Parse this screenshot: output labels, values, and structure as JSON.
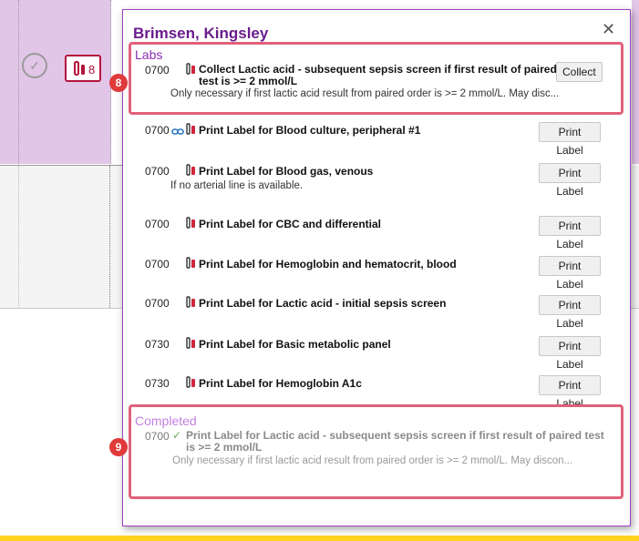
{
  "patient": {
    "name": "Brimsen, Kingsley"
  },
  "sidebar": {
    "task_count": "8"
  },
  "sections": {
    "labs": "Labs",
    "completed": "Completed"
  },
  "labs": [
    {
      "time": "0700",
      "title": "Collect Lactic acid - subsequent sepsis screen if first result of paired test is >= 2 mmol/L",
      "note": "Only necessary if first lactic acid result from paired order is >= 2 mmol/L. May disc...",
      "action": "Collect",
      "linked": false
    },
    {
      "time": "0700",
      "title": "Print Label for Blood culture, peripheral #1",
      "note": "",
      "action": "Print Label",
      "linked": true
    },
    {
      "time": "0700",
      "title": "Print Label for Blood gas, venous",
      "note": "If no arterial line is available.",
      "action": "Print Label",
      "linked": false
    },
    {
      "time": "0700",
      "title": "Print Label for CBC and differential",
      "note": "",
      "action": "Print Label",
      "linked": false
    },
    {
      "time": "0700",
      "title": "Print Label for Hemoglobin and hematocrit, blood",
      "note": "",
      "action": "Print Label",
      "linked": false
    },
    {
      "time": "0700",
      "title": "Print Label for Lactic acid - initial sepsis screen",
      "note": "",
      "action": "Print Label",
      "linked": false
    },
    {
      "time": "0730",
      "title": "Print Label for Basic metabolic panel",
      "note": "",
      "action": "Print Label",
      "linked": false
    },
    {
      "time": "0730",
      "title": "Print Label for Hemoglobin A1c",
      "note": "",
      "action": "Print Label",
      "linked": false
    }
  ],
  "completed": [
    {
      "time": "0700",
      "title": "Print Label for Lactic acid - subsequent sepsis screen if first result of paired test is >= 2 mmol/L",
      "note": "Only necessary if first lactic acid result from paired order is >= 2 mmol/L. May discon..."
    }
  ],
  "callouts": {
    "first": "8",
    "second": "9"
  },
  "icons": {
    "close": "close-icon",
    "check": "checkmark-circle-icon",
    "lab": "test-tube-icon",
    "link": "link-icon"
  },
  "colors": {
    "title": "#6a1d8c",
    "highlight": "#e0607a",
    "marker": "#e03a3a",
    "badge": "#b4143c",
    "band": "#e1c6e8",
    "bottom_bar": "#ffd21f"
  }
}
